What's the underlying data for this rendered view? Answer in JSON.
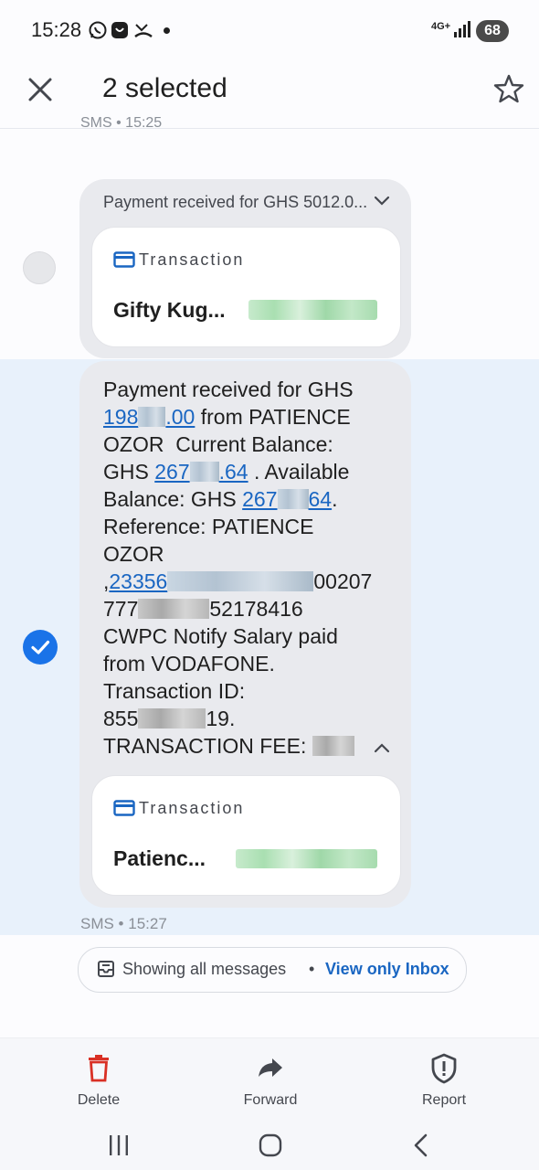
{
  "status_bar": {
    "time": "15:28",
    "network": "4G+",
    "battery": "68"
  },
  "app_bar": {
    "title": "2 selected"
  },
  "conversation": {
    "previous_meta": "SMS • 15:25",
    "collapsed_message": {
      "preview": "Payment received for GHS 5012.0...",
      "card_type": "Transaction",
      "card_name": "Gifty Kug..."
    },
    "selected_message": {
      "line1": "Payment received for GHS",
      "amount_a": "198",
      "amount_b": ".00",
      "line2_rest": " from PATIENCE",
      "line3": "OZOR  Current Balance:",
      "ghs1": "GHS ",
      "bal_a": "267",
      "bal_b": ".64",
      "line4_rest": " . Available",
      "line5_pre": "Balance: GHS ",
      "avail_a": "267",
      "avail_b": "64",
      "line5_post": ".",
      "line6": "Reference: PATIENCE",
      "line7": "OZOR",
      "ref_pre": ",",
      "ref_a": "23356",
      "ref_b": "00207",
      "ref2_a": "777",
      "ref2_b": "52178416",
      "line10": "CWPC Notify Salary paid",
      "line11": "from VODAFONE.",
      "line12": "Transaction ID:",
      "txid_a": "855",
      "txid_b": "19.",
      "line14": "TRANSACTION FEE: ",
      "card_type": "Transaction",
      "card_name": "Patienc..."
    },
    "sms_meta": "SMS • 15:27"
  },
  "filter": {
    "showing": "Showing all messages",
    "separator": "•",
    "view_inbox": "View only Inbox"
  },
  "actions": {
    "delete": "Delete",
    "forward": "Forward",
    "report": "Report"
  },
  "colors": {
    "accent": "#1a73e8",
    "delete_red": "#d93025",
    "selected_bg": "#e8f1fb",
    "bubble_bg": "#e9eaee"
  }
}
